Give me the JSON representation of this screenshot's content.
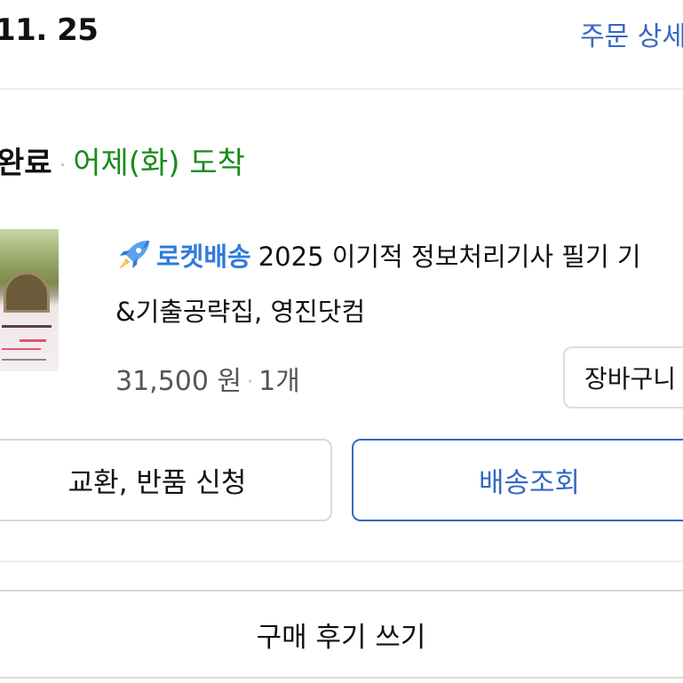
{
  "header": {
    "order_date": "11. 25",
    "order_detail_link": "주문 상세"
  },
  "status": {
    "done_label": "완료",
    "arrival_label": "어제(화) 도착",
    "color_arrival": "#198b1d"
  },
  "product": {
    "thumbnail_icon": "book-cover-image",
    "rocket_icon": "rocket-icon",
    "rocket_label": "로켓배송",
    "title_line1": "2025 이기적 정보처리기사 필기 기",
    "title_line2": "&기출공략집, 영진닷컴",
    "price": "31,500 원",
    "quantity": "1개",
    "cart_button_label": "장바구니"
  },
  "actions": {
    "exchange_label": "교환, 반품 신청",
    "tracking_label": "배송조회",
    "review_label": "구매 후기 쓰기"
  },
  "colors": {
    "accent_blue": "#3469c4",
    "rocket_blue": "#2f7bd9"
  }
}
